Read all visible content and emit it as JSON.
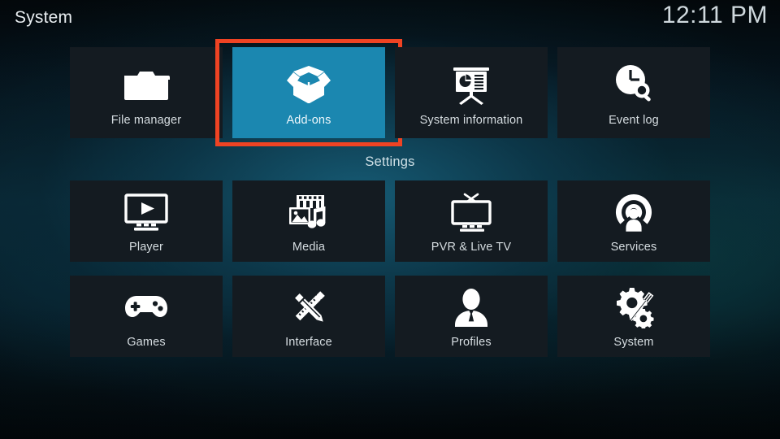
{
  "header": {
    "title": "System",
    "clock": "12:11 PM"
  },
  "settings_caption": "Settings",
  "colors": {
    "selection_fill": "#1b87b0",
    "selection_border": "#ef4323",
    "tile_background": "#141b21",
    "label_text": "#d6dde1"
  },
  "top_row": [
    {
      "label": "File manager",
      "icon": "folder-icon",
      "selected": false
    },
    {
      "label": "Add-ons",
      "icon": "open-box-icon",
      "selected": true
    },
    {
      "label": "System information",
      "icon": "presentation-chart-icon",
      "selected": false
    },
    {
      "label": "Event log",
      "icon": "clock-search-icon",
      "selected": false
    }
  ],
  "settings_rows": [
    [
      {
        "label": "Player",
        "icon": "monitor-play-icon",
        "selected": false
      },
      {
        "label": "Media",
        "icon": "film-photo-music-icon",
        "selected": false
      },
      {
        "label": "PVR & Live TV",
        "icon": "tv-antenna-icon",
        "selected": false
      },
      {
        "label": "Services",
        "icon": "broadcast-person-icon",
        "selected": false
      }
    ],
    [
      {
        "label": "Games",
        "icon": "gamepad-icon",
        "selected": false
      },
      {
        "label": "Interface",
        "icon": "pencil-ruler-cross-icon",
        "selected": false
      },
      {
        "label": "Profiles",
        "icon": "person-silhouette-icon",
        "selected": false
      },
      {
        "label": "System",
        "icon": "gears-screwdriver-icon",
        "selected": false
      }
    ]
  ]
}
